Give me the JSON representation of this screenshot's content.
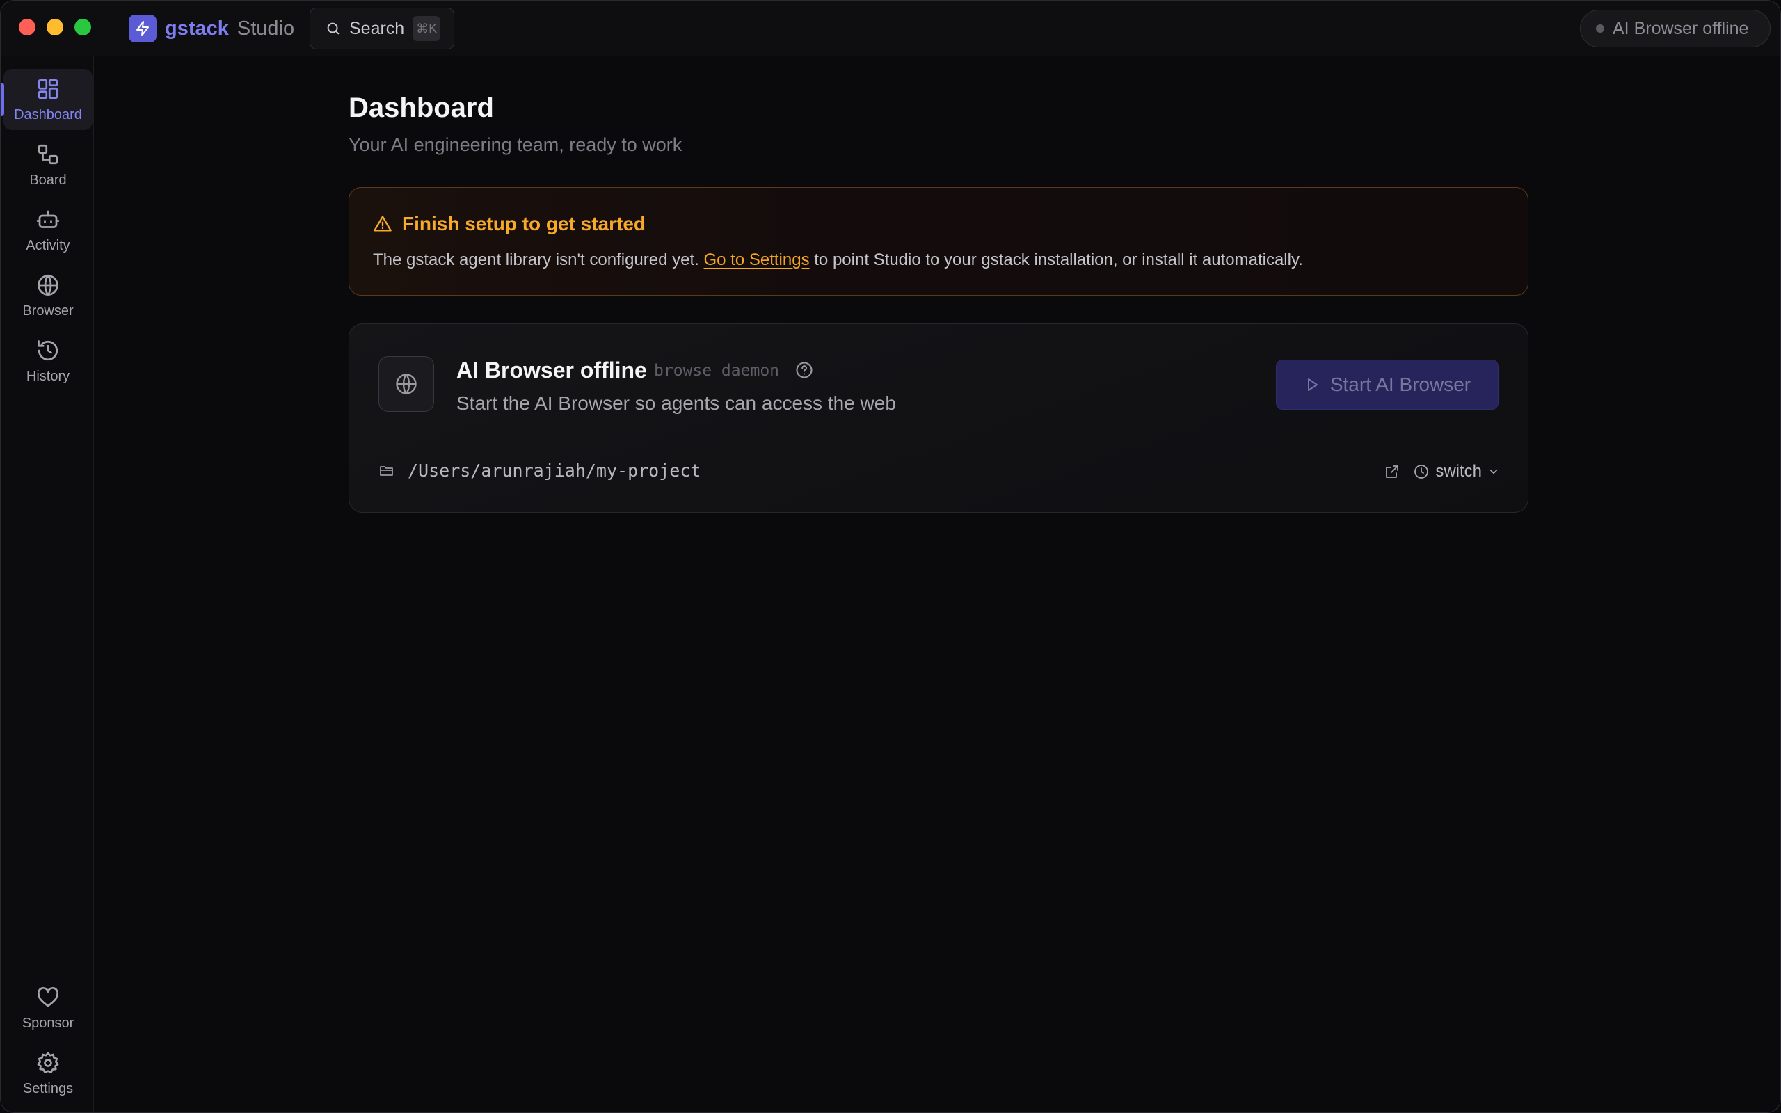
{
  "titlebar": {
    "brand_name": "gstack",
    "brand_sub": "Studio",
    "search_label": "Search",
    "search_shortcut": "⌘K",
    "status_text": "AI Browser offline"
  },
  "sidebar": {
    "items": [
      {
        "label": "Dashboard",
        "icon": "dashboard-icon",
        "active": true
      },
      {
        "label": "Board",
        "icon": "board-icon"
      },
      {
        "label": "Activity",
        "icon": "robot-icon"
      },
      {
        "label": "Browser",
        "icon": "globe-icon"
      },
      {
        "label": "History",
        "icon": "history-icon"
      }
    ],
    "bottom_items": [
      {
        "label": "Sponsor",
        "icon": "heart-icon"
      },
      {
        "label": "Settings",
        "icon": "gear-icon"
      }
    ]
  },
  "main": {
    "title": "Dashboard",
    "subtitle": "Your AI engineering team, ready to work"
  },
  "setup_banner": {
    "title": "Finish setup to get started",
    "body_before": "The gstack agent library isn't configured yet. ",
    "link_text": "Go to Settings",
    "body_after": " to point Studio to your gstack installation, or install it automatically."
  },
  "browser_card": {
    "title": "AI Browser offline",
    "tag": "browse daemon",
    "description": "Start the AI Browser so agents can access the web",
    "start_button": "Start AI Browser",
    "project_path": "/Users/arunrajiah/my-project",
    "switch_label": "switch"
  },
  "colors": {
    "accent": "#5b5bd6",
    "warning": "#f5a623",
    "background": "#0a0a0c"
  }
}
